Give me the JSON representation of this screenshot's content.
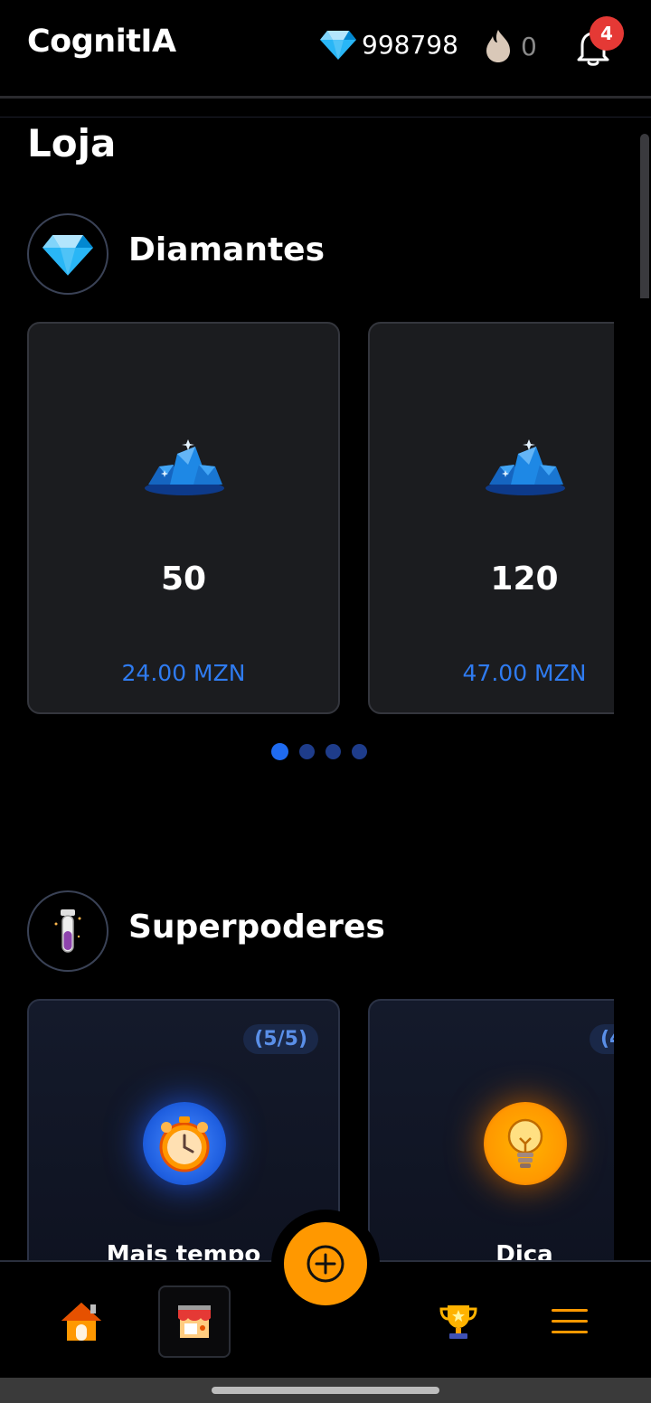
{
  "header": {
    "app_title": "CognitIA",
    "diamonds": "998798",
    "streak": "0",
    "notifications": "4"
  },
  "page": {
    "title": "Loja"
  },
  "diamonds_section": {
    "title": "Diamantes",
    "packs": [
      {
        "amount": "50",
        "price": "24.00 MZN"
      },
      {
        "amount": "120",
        "price": "47.00 MZN"
      }
    ],
    "pagination": {
      "pages": 4,
      "active": 1
    }
  },
  "powers_section": {
    "title": "Superpoderes",
    "items": [
      {
        "count": "(5/5)",
        "name": "Mais tempo"
      },
      {
        "count": "(4",
        "name": "Dica"
      }
    ]
  },
  "colors": {
    "accent": "#ff9800",
    "link_blue": "#2f7bf0",
    "badge_red": "#e53935"
  }
}
